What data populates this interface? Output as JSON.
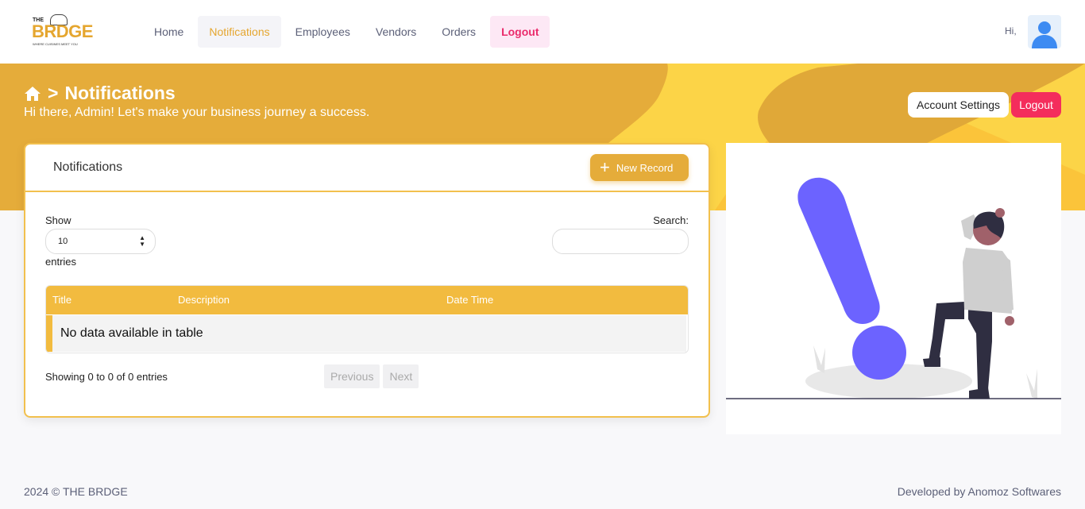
{
  "brand": {
    "logo_the": "THE",
    "logo_name": "BRDGE",
    "logo_tagline": "WHERE CUISINES MEET YOU"
  },
  "nav": {
    "items": [
      {
        "label": "Home"
      },
      {
        "label": "Notifications"
      },
      {
        "label": "Employees"
      },
      {
        "label": "Vendors"
      },
      {
        "label": "Orders"
      },
      {
        "label": "Logout"
      }
    ],
    "active": "Notifications",
    "greeting": "Hi,"
  },
  "banner": {
    "separator": ">",
    "title": "Notifications",
    "subtitle": "Hi there, Admin! Let's make your business journey a success.",
    "account_settings": "Account Settings",
    "logout": "Logout"
  },
  "card": {
    "title": "Notifications",
    "new_record": "New Record",
    "show_label": "Show",
    "page_size": "10",
    "entries_label": "entries",
    "search_label": "Search:",
    "search_value": "",
    "columns": [
      "Title",
      "Description",
      "Date Time"
    ],
    "empty_message": "No data available in table",
    "showing": "Showing 0 to 0 of 0 entries",
    "prev": "Previous",
    "next": "Next"
  },
  "footer": {
    "copyright": "2024  © THE BRDGE",
    "developer": "Developed by Anomoz Softwares"
  },
  "colors": {
    "accent": "#e5ac3a",
    "table_header": "#f2bb3f",
    "danger": "#f42d5c",
    "illustration": "#6c63ff"
  }
}
